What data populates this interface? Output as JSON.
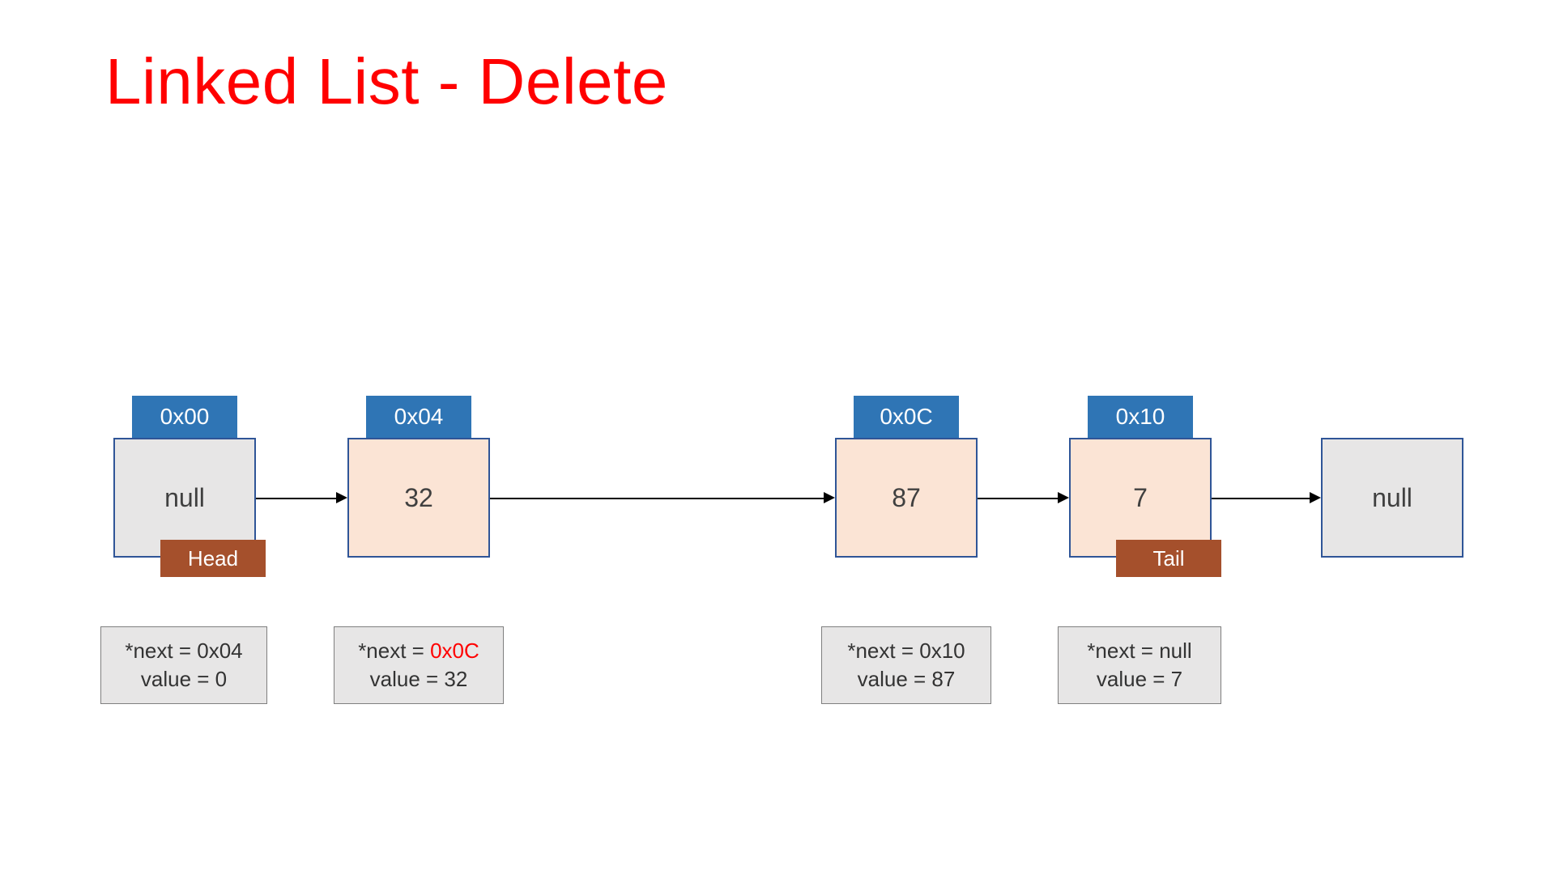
{
  "title": "Linked List - Delete",
  "nodes": {
    "n0": {
      "addr": "0x00",
      "value": "null",
      "tag": "Head",
      "next_label": "*next = ",
      "next_val": "0x04",
      "next_hl": false,
      "val_label": "value = 0"
    },
    "n1": {
      "addr": "0x04",
      "value": "32",
      "next_label": "*next = ",
      "next_val": "0x0C",
      "next_hl": true,
      "val_label": "value = 32"
    },
    "n2": {
      "addr": "0x0C",
      "value": "87",
      "next_label": "*next = ",
      "next_val": "0x10",
      "next_hl": false,
      "val_label": "value = 87"
    },
    "n3": {
      "addr": "0x10",
      "value": "7",
      "tag": "Tail",
      "next_label": "*next = ",
      "next_val": "null",
      "next_hl": false,
      "val_label": "value = 7"
    },
    "end": {
      "value": "null"
    }
  }
}
